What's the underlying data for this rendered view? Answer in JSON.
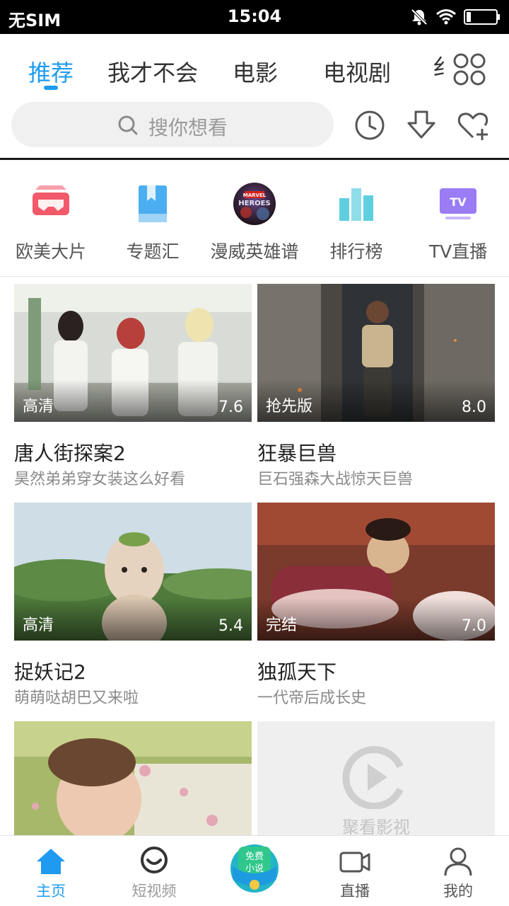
{
  "status_bar": {
    "carrier": "无SIM",
    "time": "15:04"
  },
  "tabs": [
    {
      "label": "推荐",
      "active": true
    },
    {
      "label": "我才不会",
      "active": false
    },
    {
      "label": "电影",
      "active": false
    },
    {
      "label": "电视剧",
      "active": false
    },
    {
      "label": "纟",
      "active": false
    }
  ],
  "search": {
    "placeholder": "搜你想看"
  },
  "shortcuts": [
    {
      "label": "欧美大片",
      "icon": "vr-glasses-icon",
      "color": "#f2596a"
    },
    {
      "label": "专题汇",
      "icon": "bookmark-book-icon",
      "color": "#4aaef0"
    },
    {
      "label": "漫威英雄谱",
      "icon": "marvel-heroes-logo",
      "logo_text": [
        "MARVEL",
        "HEROES"
      ]
    },
    {
      "label": "排行榜",
      "icon": "bar-chart-icon",
      "color": "#5fcfe0"
    },
    {
      "label": "TV直播",
      "icon": "tv-icon",
      "color": "#9a7cf5",
      "icon_text": "TV"
    }
  ],
  "videos": [
    {
      "title": "唐人街探案2",
      "subtitle": "昊然弟弟穿女装这么好看",
      "quality": "高清",
      "score": "7.6"
    },
    {
      "title": "狂暴巨兽",
      "subtitle": "巨石强森大战惊天巨兽",
      "quality": "抢先版",
      "score": "8.0"
    },
    {
      "title": "捉妖记2",
      "subtitle": "萌萌哒胡巴又来啦",
      "quality": "高清",
      "score": "5.4"
    },
    {
      "title": "独孤天下",
      "subtitle": "一代帝后成长史",
      "quality": "完结",
      "score": "7.0"
    }
  ],
  "placeholder_card": {
    "text": "聚看影视"
  },
  "bottom_nav": [
    {
      "label": "主页",
      "icon": "home-icon",
      "active": true
    },
    {
      "label": "短视频",
      "icon": "short-video-icon",
      "active": false
    },
    {
      "label": "",
      "icon": "free-novel-icon",
      "badge_text": [
        "免费",
        "小说"
      ],
      "active": false
    },
    {
      "label": "直播",
      "icon": "live-camera-icon",
      "active": false
    },
    {
      "label": "我的",
      "icon": "profile-icon",
      "active": false
    }
  ],
  "colors": {
    "accent": "#1e9bf0",
    "text": "#222222",
    "subtext": "#8a8a8a"
  }
}
